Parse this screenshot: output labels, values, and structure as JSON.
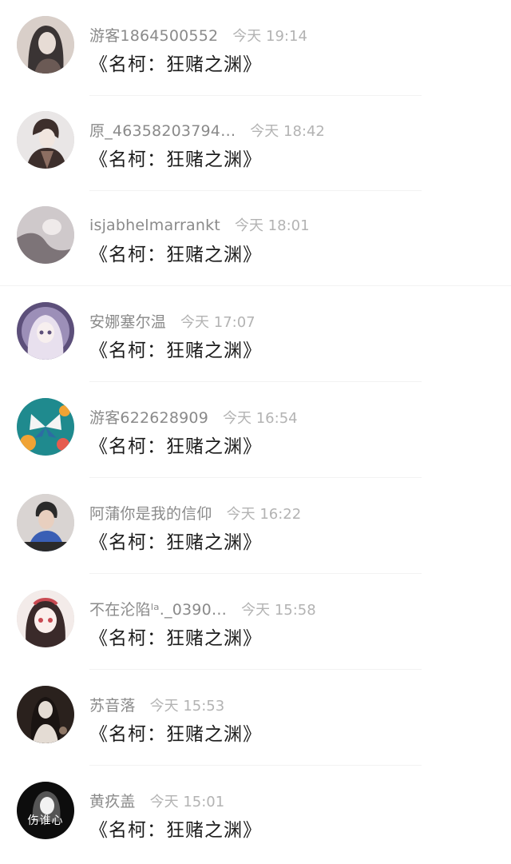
{
  "comments": [
    {
      "username": "游客1864500552",
      "time": "今天 19:14",
      "text": "《名柯：狂赌之渊》",
      "avatar_colors": [
        "#3a3434",
        "#d9cfc9",
        "#6b5a55"
      ],
      "avatar_desc": "woman-portrait-icon"
    },
    {
      "username": "原_46358203794…",
      "time": "今天 18:42",
      "text": "《名柯：狂赌之渊》",
      "avatar_colors": [
        "#e9e6e6",
        "#3d2f2c",
        "#8c6e62"
      ],
      "avatar_desc": "anime-man-icon"
    },
    {
      "username": "isjabhelmarrankt",
      "time": "今天 18:01",
      "text": "《名柯：狂赌之渊》",
      "avatar_colors": [
        "#cfc9cb",
        "#7d7478",
        "#efeaea"
      ],
      "avatar_desc": "grey-figure-icon"
    },
    {
      "username": "安娜塞尔温",
      "time": "今天 17:07",
      "text": "《名柯：狂赌之渊》",
      "avatar_colors": [
        "#e8e0ee",
        "#9c8fb8",
        "#5c4f7a"
      ],
      "avatar_desc": "anime-girl-icon"
    },
    {
      "username": "游客622628909",
      "time": "今天 16:54",
      "text": "《名柯：狂赌之渊》",
      "avatar_colors": [
        "#1f8a8e",
        "#f0a334",
        "#2d6da3"
      ],
      "avatar_desc": "butterfly-icon"
    },
    {
      "username": "阿蒲你是我的信仰",
      "time": "今天 16:22",
      "text": "《名柯：狂赌之渊》",
      "avatar_colors": [
        "#d9d4d2",
        "#2a2a2a",
        "#3a5fb5"
      ],
      "avatar_desc": "man-photo-icon"
    },
    {
      "username": "不在沦陷ˡᵃ._0390…",
      "time": "今天 15:58",
      "text": "《名柯：狂赌之渊》",
      "avatar_colors": [
        "#f3ebe9",
        "#3a2a2a",
        "#c94a52"
      ],
      "avatar_desc": "anime-girl-red-icon"
    },
    {
      "username": "苏音落",
      "time": "今天 15:53",
      "text": "《名柯：狂赌之渊》",
      "avatar_colors": [
        "#2a211d",
        "#e4dcd4",
        "#8e7766"
      ],
      "avatar_desc": "girl-dark-icon"
    },
    {
      "username": "黄疚盖",
      "time": "今天 15:01",
      "text": "《名柯：狂赌之渊》",
      "avatar_colors": [
        "#0d0d0d",
        "#f2f2f2",
        "#555555"
      ],
      "avatar_desc": "bw-portrait-icon",
      "avatar_label": "伤谁心"
    }
  ]
}
